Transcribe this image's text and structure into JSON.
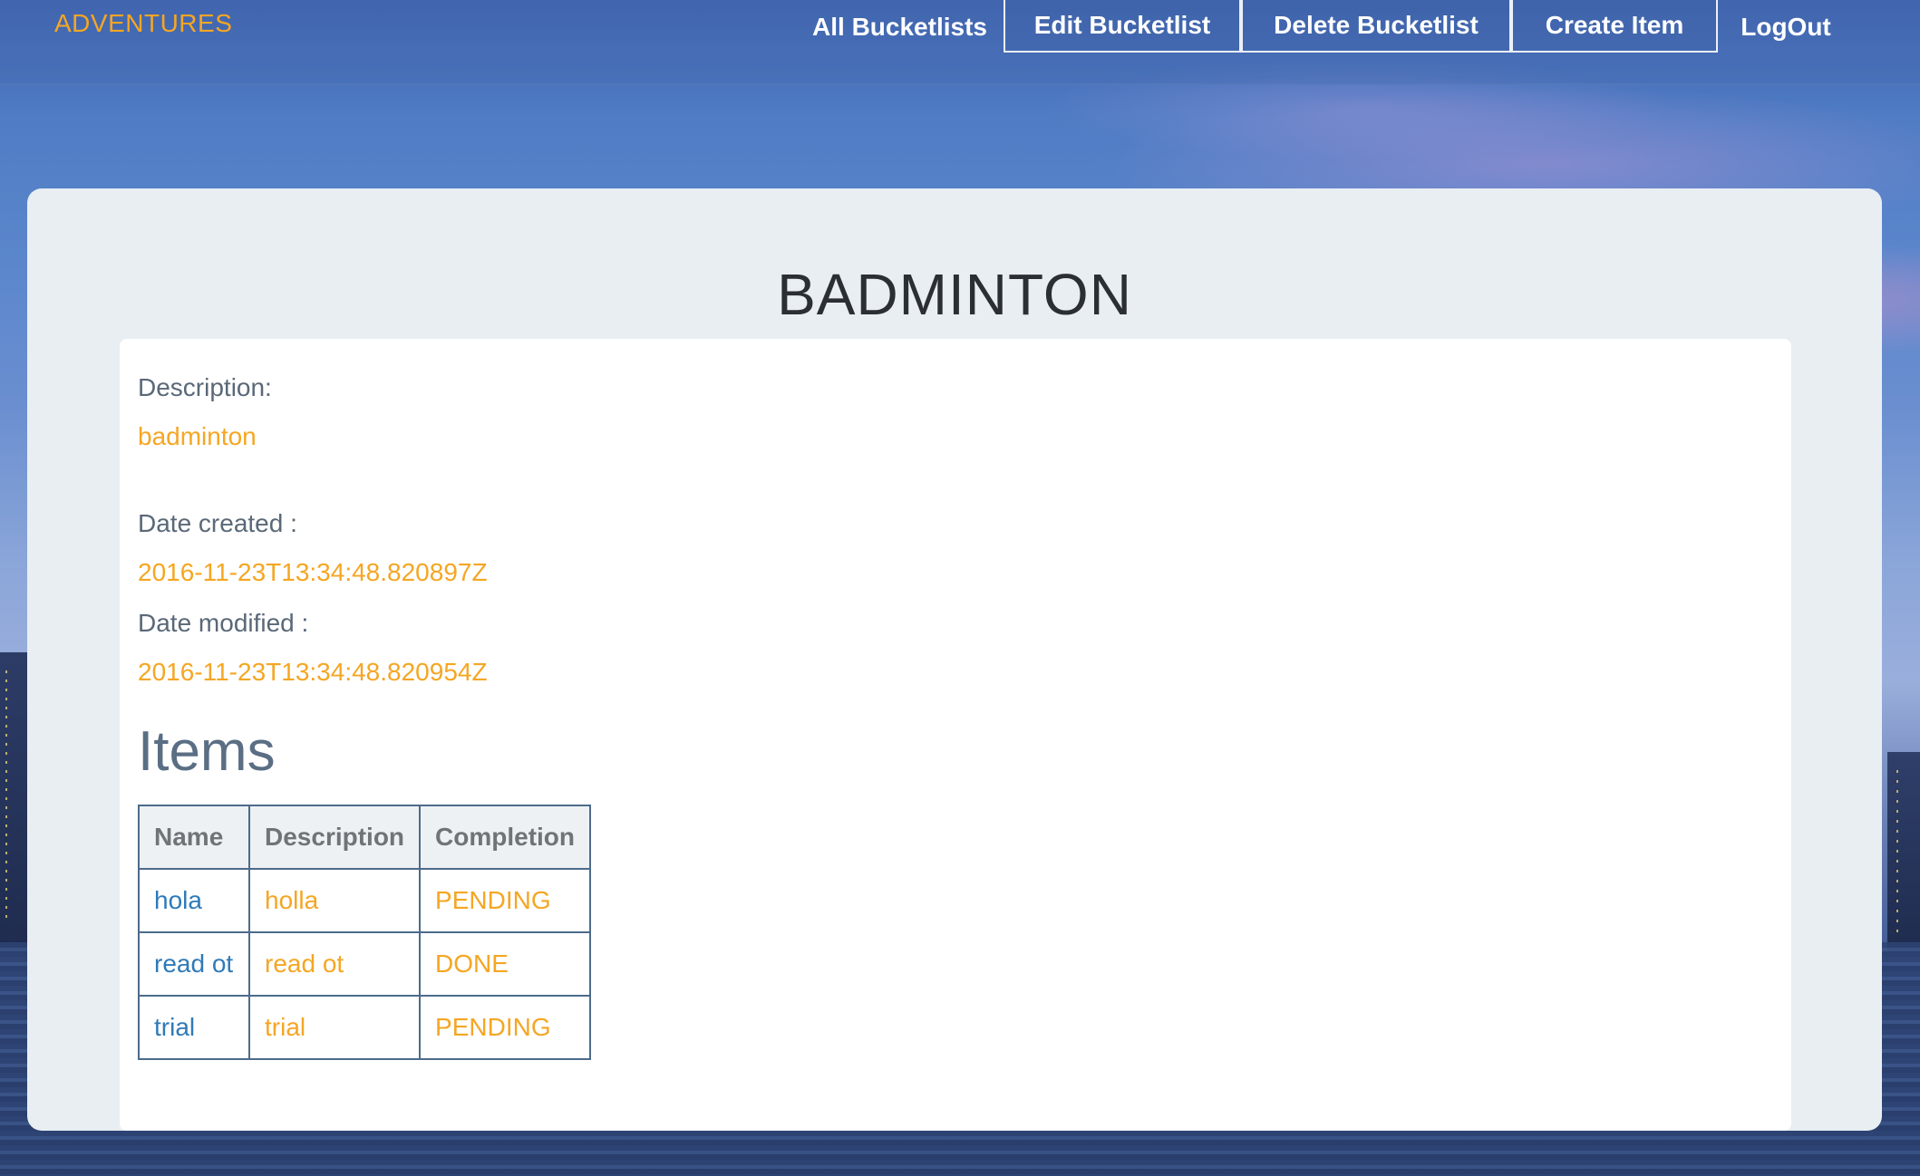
{
  "navbar": {
    "brand": "ADVENTURES",
    "links": {
      "all_bucketlists": "All Bucketlists",
      "edit_bucketlist": "Edit Bucketlist",
      "delete_bucketlist": "Delete Bucketlist",
      "create_item": "Create Item",
      "logout": "LogOut"
    }
  },
  "bucketlist": {
    "title": "BADMINTON",
    "description_label": "Description:",
    "description": "badminton",
    "date_created_label": "Date created :",
    "date_created": "2016-11-23T13:34:48.820897Z",
    "date_modified_label": "Date modified :",
    "date_modified": "2016-11-23T13:34:48.820954Z"
  },
  "items": {
    "heading": "Items",
    "columns": {
      "name": "Name",
      "description": "Description",
      "completion": "Completion"
    },
    "rows": [
      {
        "name": "hola",
        "description": "holla",
        "completion": "PENDING"
      },
      {
        "name": "read ot",
        "description": "read ot",
        "completion": "DONE"
      },
      {
        "name": "trial",
        "description": "trial",
        "completion": "PENDING"
      }
    ]
  },
  "colors": {
    "accent": "#f5a623",
    "link_blue": "#2f7ab8",
    "panel_bg": "#e8eef2",
    "table_border": "#4d6b8a"
  }
}
